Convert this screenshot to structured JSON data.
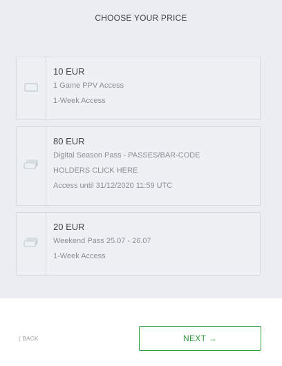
{
  "title": "CHOOSE YOUR PRICE",
  "options": [
    {
      "price": "10 EUR",
      "lines": [
        "1 Game PPV Access",
        "1-Week Access"
      ],
      "icon": "single-ticket-icon"
    },
    {
      "price": "80 EUR",
      "lines": [
        "Digital Season Pass - PASSES/BAR-CODE",
        "HOLDERS CLICK HERE",
        "Access until 31/12/2020 11:59 UTC"
      ],
      "icon": "multi-ticket-icon"
    },
    {
      "price": "20 EUR",
      "lines": [
        "Weekend Pass 25.07 - 26.07",
        "1-Week Access"
      ],
      "icon": "multi-ticket-icon"
    }
  ],
  "footer": {
    "back_label": "( BACK",
    "next_label": "NEXT →"
  },
  "colors": {
    "panel_bg": "#eaeef2",
    "accent": "#2e9a3a",
    "border": "#d4dade"
  }
}
